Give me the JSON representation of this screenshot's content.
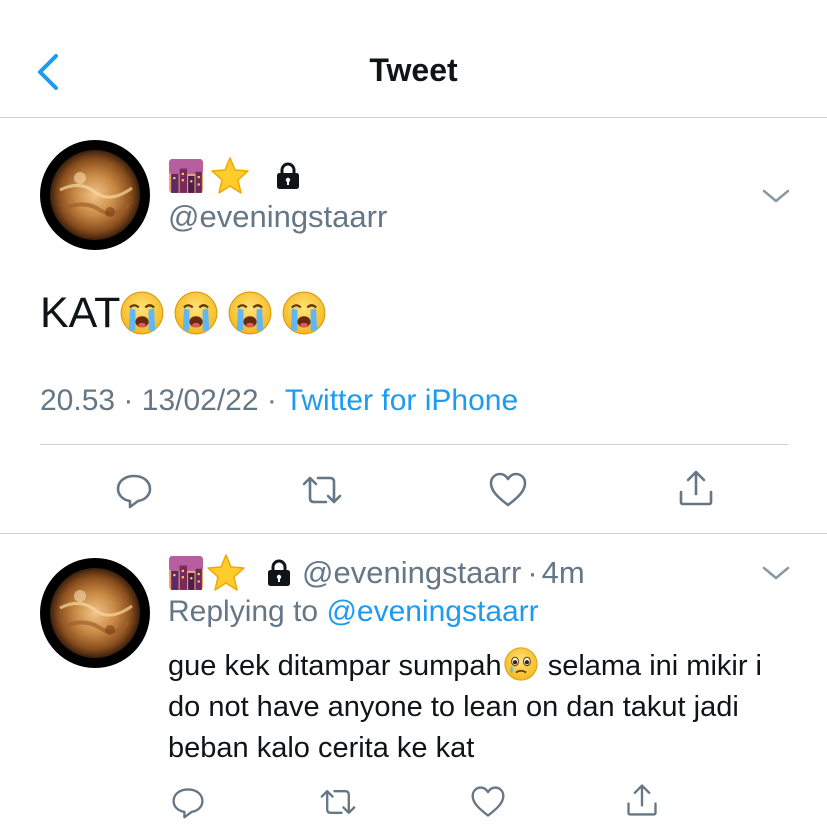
{
  "header": {
    "title": "Tweet"
  },
  "tweet": {
    "handle": "@eveningstaarr",
    "text": "KAT",
    "time": "20.53",
    "date": "13/02/22",
    "separator": "·",
    "source": "Twitter for iPhone"
  },
  "reply": {
    "handle": "@eveningstaarr",
    "separator": "·",
    "age": "4m",
    "replying_label": "Replying to",
    "replying_to": "@eveningstaarr",
    "text_part1": "gue kek ditampar sumpah",
    "text_part2": "selama ini mikir i do not have anyone to lean on dan takut jadi beban kalo cerita ke kat"
  },
  "colors": {
    "accent": "#1d9bf0",
    "secondary_text": "#657786",
    "divider": "#d0d0d4"
  },
  "icons": [
    "chevron-left-icon",
    "city-sunset-emoji",
    "star-emoji",
    "lock-icon",
    "chevron-down-icon",
    "loudly-crying-face-emoji",
    "reply-icon",
    "retweet-icon",
    "like-icon",
    "share-icon",
    "face-holding-back-tears-emoji"
  ]
}
